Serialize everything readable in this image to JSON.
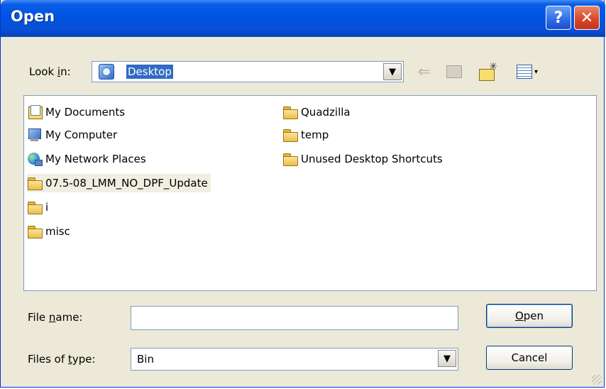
{
  "window": {
    "title": "Open",
    "help_label": "?",
    "close_label": "✕"
  },
  "lookin": {
    "label_prefix": "Look ",
    "label_accel": "i",
    "label_suffix": "n:",
    "value": "Desktop"
  },
  "toolbar": {
    "back_glyph": "⇐",
    "views_arrow": "▾"
  },
  "files": {
    "column1": [
      {
        "name": "My Documents",
        "icon": "my-documents-icon"
      },
      {
        "name": "My Computer",
        "icon": "computer-icon"
      },
      {
        "name": "My Network Places",
        "icon": "network-icon"
      },
      {
        "name": "07.5-08_LMM_NO_DPF_Update",
        "icon": "folder-icon"
      },
      {
        "name": "i",
        "icon": "folder-icon"
      },
      {
        "name": "misc",
        "icon": "folder-icon"
      }
    ],
    "column2": [
      {
        "name": "Quadzilla",
        "icon": "folder-icon"
      },
      {
        "name": "temp",
        "icon": "folder-icon"
      },
      {
        "name": "Unused Desktop Shortcuts",
        "icon": "folder-icon"
      }
    ]
  },
  "filename": {
    "label_prefix": "File ",
    "label_accel": "n",
    "label_suffix": "ame:",
    "value": "",
    "placeholder": ""
  },
  "filetype": {
    "label_prefix": "Files of ",
    "label_accel": "t",
    "label_suffix": "ype:",
    "value": "Bin"
  },
  "buttons": {
    "open_accel": "O",
    "open_rest": "pen",
    "cancel": "Cancel"
  },
  "colors": {
    "titlebar": "#0054e3",
    "selection": "#316ac5",
    "face": "#ece9d8"
  }
}
